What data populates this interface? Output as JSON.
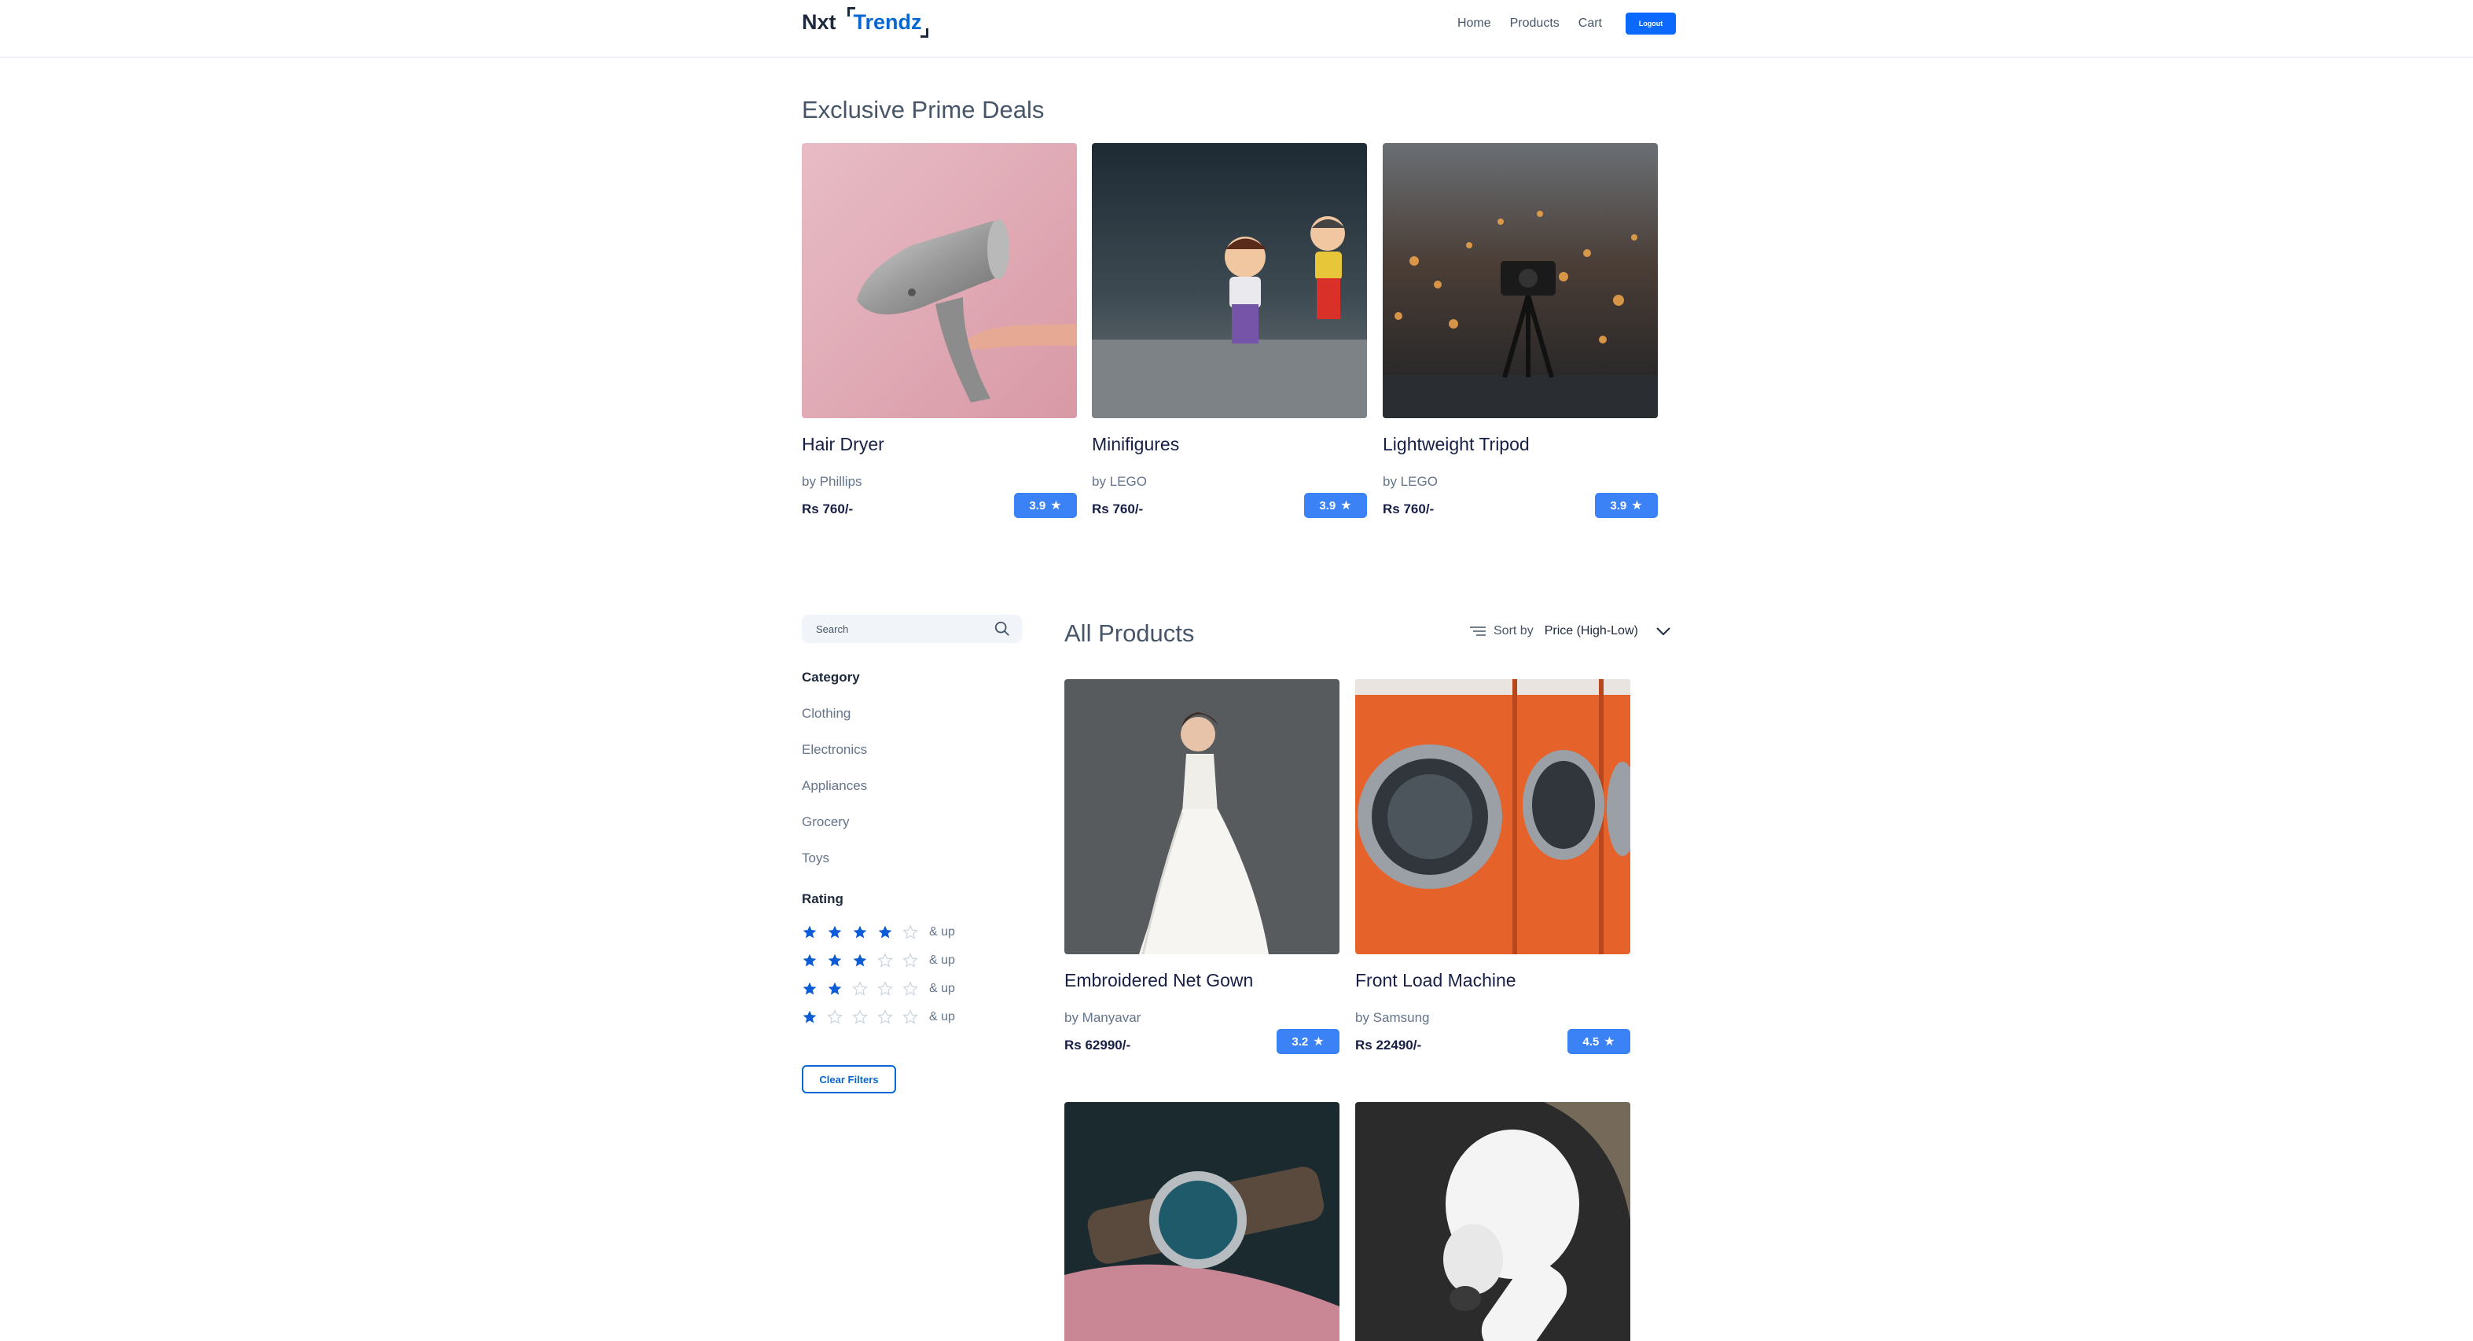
{
  "header": {
    "logo_nxt": "Nxt",
    "logo_trendz": "Trendz",
    "nav": [
      "Home",
      "Products",
      "Cart"
    ],
    "logout_label": "Logout"
  },
  "prime": {
    "title": "Exclusive Prime Deals",
    "items": [
      {
        "name": "Hair Dryer",
        "brand": "by Phillips",
        "price": "Rs 760/-",
        "rating": "3.9"
      },
      {
        "name": "Minifigures",
        "brand": "by LEGO",
        "price": "Rs 760/-",
        "rating": "3.9"
      },
      {
        "name": "Lightweight Tripod",
        "brand": "by LEGO",
        "price": "Rs 760/-",
        "rating": "3.9"
      }
    ]
  },
  "filters": {
    "search_placeholder": "Search",
    "category_heading": "Category",
    "categories": [
      "Clothing",
      "Electronics",
      "Appliances",
      "Grocery",
      "Toys"
    ],
    "rating_heading": "Rating",
    "ratings": [
      {
        "stars": 4,
        "label": "& up"
      },
      {
        "stars": 3,
        "label": "& up"
      },
      {
        "stars": 2,
        "label": "& up"
      },
      {
        "stars": 1,
        "label": "& up"
      }
    ],
    "clear_label": "Clear Filters"
  },
  "products": {
    "title": "All Products",
    "sort_label": "Sort by",
    "sort_value": "Price (High-Low)",
    "items": [
      {
        "name": "Embroidered Net Gown",
        "brand": "by Manyavar",
        "price": "Rs 62990/-",
        "rating": "3.2"
      },
      {
        "name": "Front Load Machine",
        "brand": "by Samsung",
        "price": "Rs 22490/-",
        "rating": "4.5"
      }
    ]
  },
  "colors": {
    "accent": "#0967d2",
    "badge": "#3b82f6",
    "star_filled": "#0b5cd5",
    "star_empty": "#cbd5e1"
  }
}
